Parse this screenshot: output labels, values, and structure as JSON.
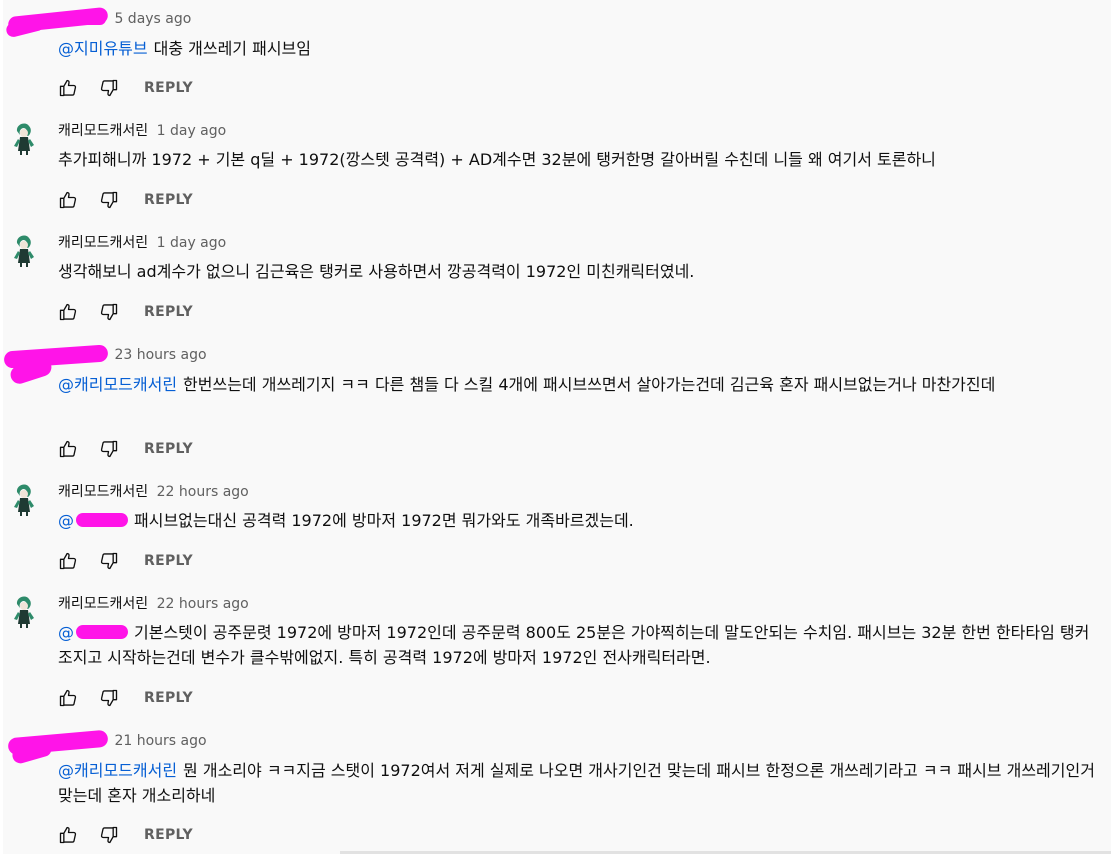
{
  "reply_label": "REPLY",
  "comments": [
    {
      "author": "",
      "time": "5 days ago",
      "mention": "@지미유튜브",
      "text": "대충 개쓰레기 패시브임"
    },
    {
      "author": "캐리모드캐서린",
      "time": "1 day ago",
      "mention": "",
      "text": "추가피해니까 1972 + 기본 q딜 + 1972(깡스텟 공격력) + AD계수면 32분에 탱커한명 갈아버릴 수친데 니들 왜 여기서 토론하니"
    },
    {
      "author": "캐리모드캐서린",
      "time": "1 day ago",
      "mention": "",
      "text": "생각해보니 ad계수가 없으니 김근육은 탱커로 사용하면서 깡공격력이 1972인 미친캐릭터였네."
    },
    {
      "author": "",
      "time": "23 hours ago",
      "mention": "@캐리모드캐서린",
      "text": "한번쓰는데 개쓰레기지 ㅋㅋ 다른 챔들 다 스킬 4개에 패시브쓰면서 살아가는건데 김근육 혼자 패시브없는거나 마찬가진데"
    },
    {
      "author": "캐리모드캐서린",
      "time": "22 hours ago",
      "mention": "@",
      "text": "패시브없는대신 공격력 1972에 방마저 1972면 뭐가와도 개족바르겠는데."
    },
    {
      "author": "캐리모드캐서린",
      "time": "22 hours ago",
      "mention": "@",
      "text": "기본스텟이 공주문렷 1972에 방마저 1972인데 공주문력 800도 25분은 가야찍히는데 말도안되는 수치임. 패시브는 32분 한번 한타타임 탱커 조지고 시작하는건데 변수가 클수밖에없지. 특히 공격력 1972에 방마저 1972인 전사캐릭터라면."
    },
    {
      "author": "",
      "time": "21 hours ago",
      "mention": "@캐리모드캐서린",
      "text": "뭔 개소리야 ㅋㅋ지금 스탯이 1972여서 저게 실제로 나오면 개사기인건 맞는데 패시브 한정으론 개쓰레기라고 ㅋㅋ 패시브 개쓰레기인거 맞는데 혼자 개소리하네"
    }
  ]
}
